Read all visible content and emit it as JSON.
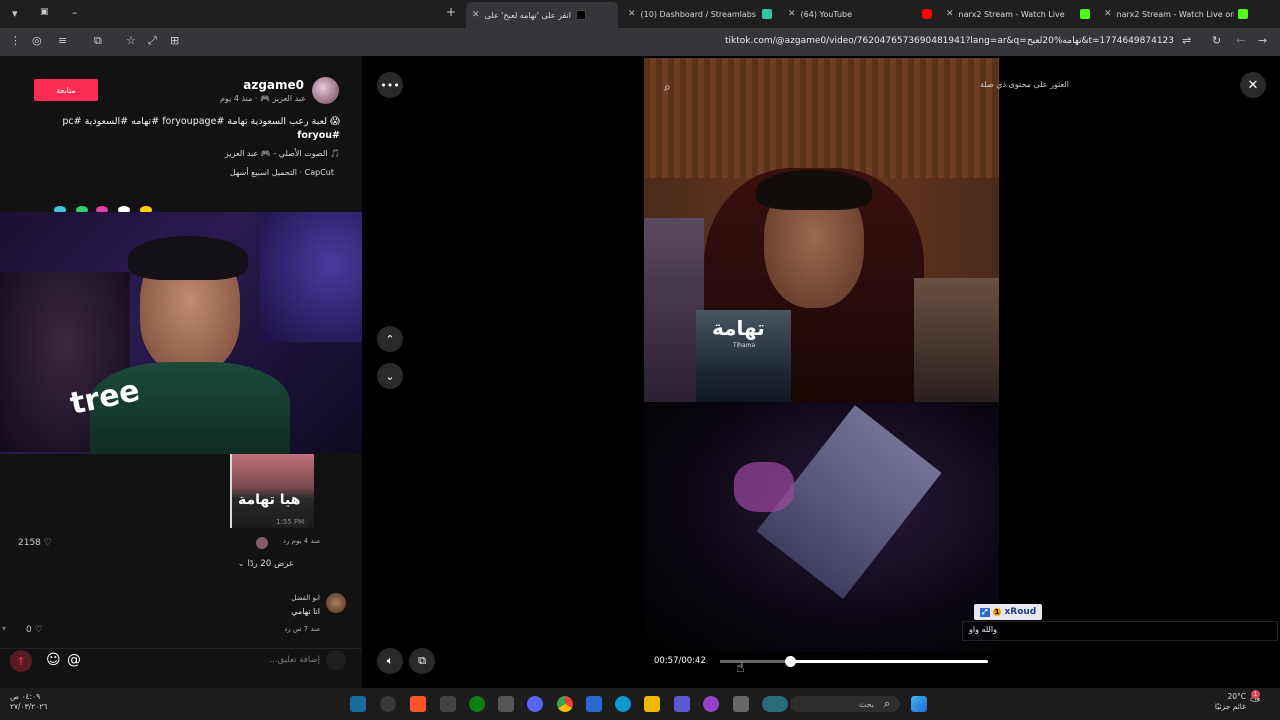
{
  "browser": {
    "tabs": [
      {
        "title": "انقر على 'تهامه لعبح' على",
        "active": true
      },
      {
        "title": "(10) Dashboard / Streamlabs"
      },
      {
        "title": "(64) YouTube"
      },
      {
        "title": "narx2 Stream - Watch Live"
      },
      {
        "title": "narx2 Stream - Watch Live on K"
      }
    ],
    "url": "tiktok.com/@azgame0/video/7620476573690481941?lang=ar&q=تهامه%20لعبح&t=1774649874123"
  },
  "post": {
    "follow_label": "متابعة",
    "username": "azgame0",
    "meta": "عبد العزيز 🎮 · منذ 4 يوم",
    "caption": "😱 لعبة رعب السعودية تهامة #foryoupage #تهامه #السعودية #pc",
    "caption_line2": "#foryou",
    "music": "🎵 الصوت الأصلي - 🎮 عبد العزيز",
    "capcut": "CapCut · التحميل اسبيع أسهل"
  },
  "comments": {
    "image_text": "هيا تهامة",
    "image_time": "1:55 PM",
    "likes_1": "2158",
    "reply_meta": "منذ 4 يوم   رد",
    "view_replies": "عرض 20 ردًا",
    "c2_name": "ابو الفضل",
    "c2_text": "انا تهامي",
    "c2_meta": "منذ 7 س   رد",
    "likes_2": "0",
    "add_placeholder": "إضافة تعليق..."
  },
  "video": {
    "search_overlay": "العثور على محتوى ذي صلة",
    "album_title": "تهامة",
    "album_sub": "Tihama",
    "current_time": "00:57/00:42",
    "progress": 0.26
  },
  "chat": {
    "badge_name": "xRoud",
    "message": "والله واو"
  },
  "taskbar": {
    "time": "٠٤:٠٩ ص",
    "date": "٢٧/٠٣/٢٠٢٦",
    "search_label": "بحث",
    "temp": "20°C",
    "weather": "غائم جزئيًا"
  }
}
